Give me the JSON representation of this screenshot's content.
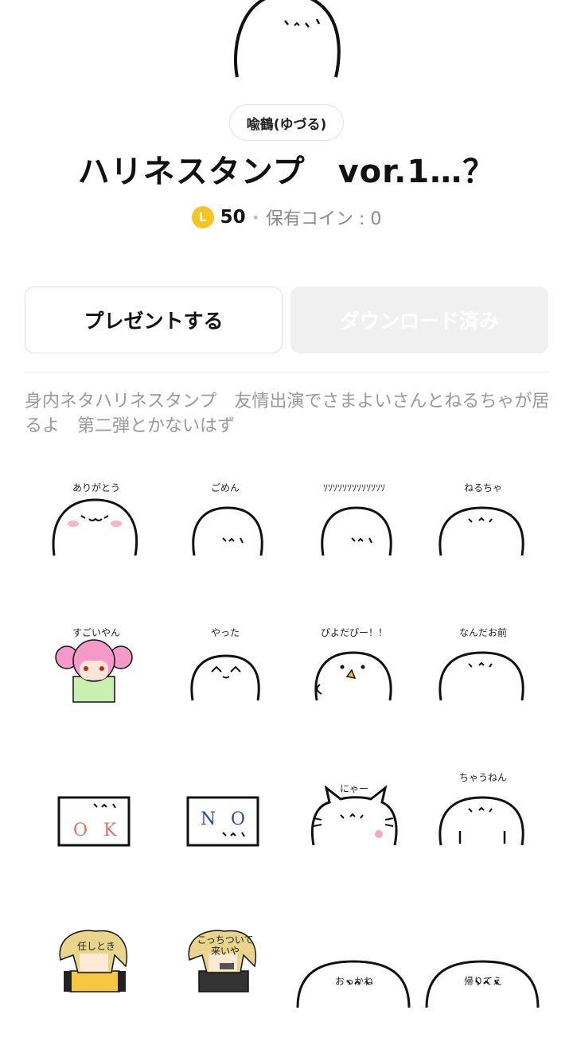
{
  "author": "喩鶴(ゆづる)",
  "title": "ハリネスタンプ　vor.1…？",
  "price": {
    "coin_symbol": "L",
    "amount": "50",
    "separator": "•",
    "owned_label": "保有コイン : 0",
    "coin_color": "#f7c520"
  },
  "actions": {
    "present_label": "プレゼントする",
    "download_label": "ダウンロード済み"
  },
  "description": "身内ネタハリネスタンプ　友情出演でさまよいさんとねるちゃが居るよ　第二弾とかないはず",
  "stickers": [
    {
      "caption": "ありがとう",
      "kind": "blob-blush"
    },
    {
      "caption": "ごめん",
      "kind": "blob-side"
    },
    {
      "caption": "ｿｿｿｿｿｿｿｿｿｿｿｿｿ",
      "kind": "blob-side"
    },
    {
      "caption": "ねるちゃ",
      "kind": "blob"
    },
    {
      "caption": "すごいやん",
      "kind": "pink-girl"
    },
    {
      "caption": "やった",
      "kind": "blob-happy"
    },
    {
      "caption": "ぴよだぴー！！",
      "kind": "bird"
    },
    {
      "caption": "なんだお前",
      "kind": "blob"
    },
    {
      "caption": "O K",
      "kind": "sign-ok"
    },
    {
      "caption": "N O",
      "kind": "sign-no"
    },
    {
      "caption": "にゃー",
      "kind": "cat"
    },
    {
      "caption": "ちゃうねん",
      "kind": "blob-arms"
    },
    {
      "caption": "任しとき",
      "kind": "blond"
    },
    {
      "caption": "こっちついて\n来いや",
      "kind": "blond-dark"
    },
    {
      "caption": "おっかね",
      "kind": "blob-low"
    },
    {
      "caption": "帰りてえ",
      "kind": "blob-low"
    }
  ]
}
